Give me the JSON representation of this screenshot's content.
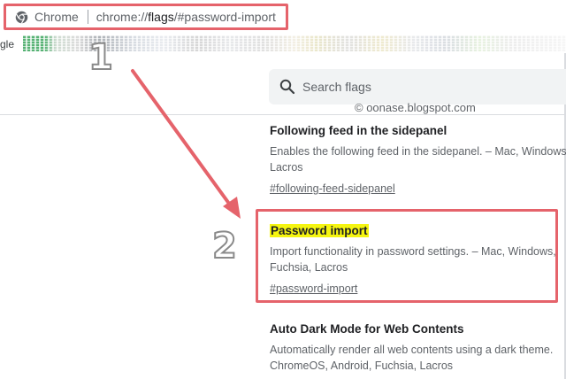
{
  "browser": {
    "site_chip": "Chrome",
    "url_prefix": "chrome://",
    "url_highlight": "flags",
    "url_suffix": "/#password-import"
  },
  "bookmarks_bar": {
    "partial_label": "gle"
  },
  "search": {
    "placeholder": "Search flags"
  },
  "watermark": "© oonase.blogspot.com",
  "annotations": {
    "step1": "1",
    "step2": "2",
    "accent_color": "#e5636b"
  },
  "flags": [
    {
      "title": "Following feed in the sidepanel",
      "description_line1": "Enables the following feed in the sidepanel. – Mac, Windows,",
      "description_line2": "Lacros",
      "link": "#following-feed-sidepanel"
    },
    {
      "title": "Password import",
      "description_line1": "Import functionality in password settings. – Mac, Windows,",
      "description_line2": "Fuchsia, Lacros",
      "link": "#password-import",
      "highlight_color": "#f5f511"
    },
    {
      "title": "Auto Dark Mode for Web Contents",
      "description_line1": "Automatically render all web contents using a dark theme.",
      "description_line2": "ChromeOS, Android, Fuchsia, Lacros"
    }
  ]
}
